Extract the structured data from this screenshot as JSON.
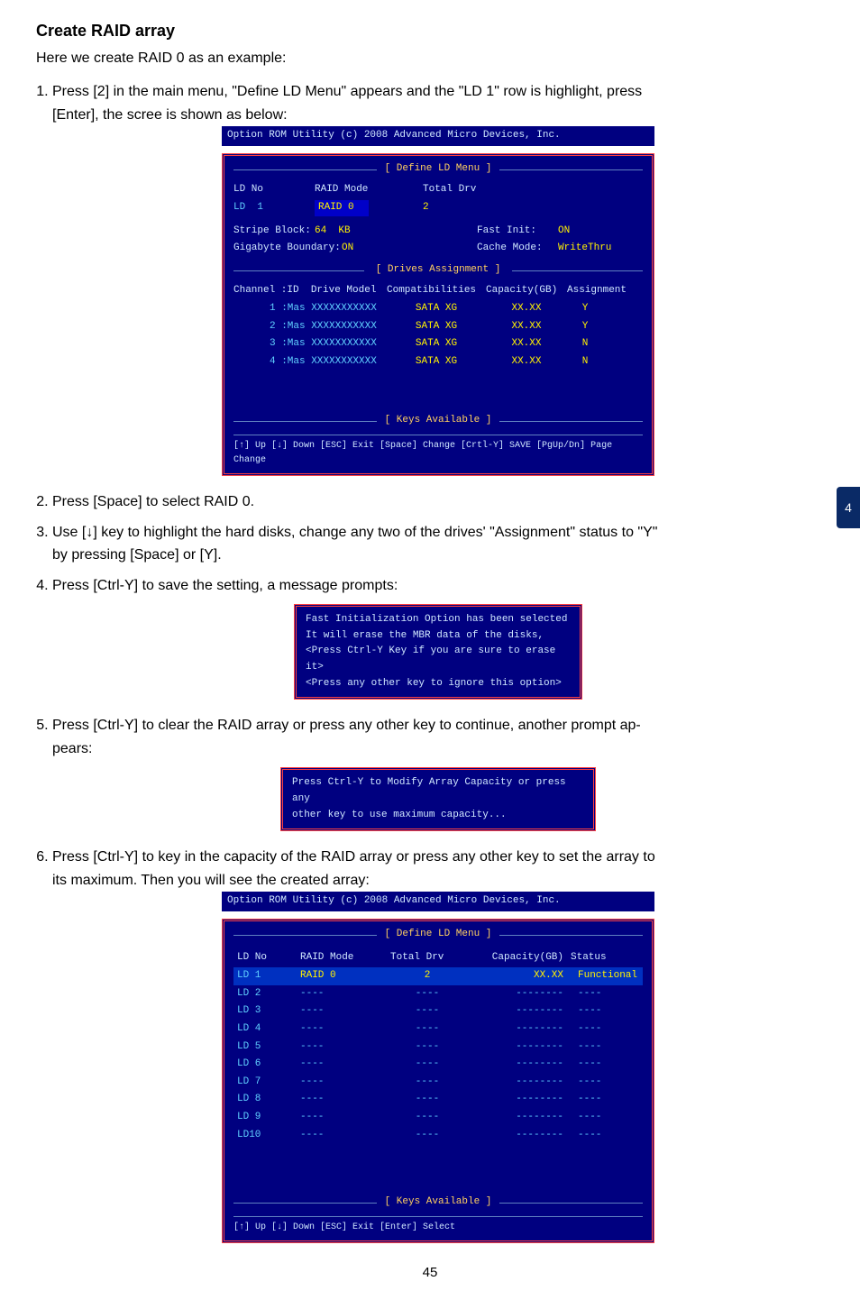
{
  "page": {
    "heading": "Create RAID array",
    "intro": "Here we create RAID 0 as an example:",
    "pageNumber": "45",
    "sideTab": "4"
  },
  "steps": {
    "s1a": "Press [2] in the main menu, \"Define LD Menu\" appears and the \"LD 1\" row is highlight, press",
    "s1b": "[Enter], the scree is shown as below:",
    "s2": "Press [Space] to select RAID 0.",
    "s3a": "Use [↓] key to highlight the hard disks, change any two of the drives' \"Assignment\" status to \"Y\"",
    "s3b": "by pressing [Space] or [Y].",
    "s4": "Press [Ctrl-Y] to save the setting, a message prompts:",
    "s5a": "Press [Ctrl-Y] to clear the RAID array or press any other key to continue, another prompt ap-",
    "s5b": "pears:",
    "s6a": "Press [Ctrl-Y] to key in the capacity of the RAID array or press any other key to set the array to",
    "s6b": "its maximum. Then you will see the created array:"
  },
  "bios1": {
    "topline": "Option ROM Utility (c) 2008 Advanced Micro Devices, Inc.",
    "menuTitle": "[ Define LD Menu ]",
    "ldno": "LD No",
    "raidmode": "RAID Mode",
    "totaldrv": "Total Drv",
    "ld1": "LD  1",
    "raid0": "RAID 0",
    "two": "2",
    "stripeLabel": "Stripe Block:",
    "stripeVal": "64  KB",
    "gigabyteLabel": "Gigabyte Boundary:",
    "gigabyteVal": "ON",
    "fastInitLabel": "Fast Init:",
    "fastInitVal": "ON",
    "cacheModeLabel": "Cache Mode:",
    "cacheModeVal": "WriteThru",
    "drivesTitle": "[ Drives Assignment ]",
    "colChannel": "Channel :ID  Drive Model",
    "colCompat": "Compatibilities",
    "colCap": "Capacity(GB)",
    "colAssign": "Assignment",
    "rows": [
      {
        "model": "1 :Mas XXXXXXXXXXX",
        "compat": "SATA XG",
        "cap": "XX.XX",
        "assign": "Y"
      },
      {
        "model": "2 :Mas XXXXXXXXXXX",
        "compat": "SATA XG",
        "cap": "XX.XX",
        "assign": "Y"
      },
      {
        "model": "3 :Mas XXXXXXXXXXX",
        "compat": "SATA XG",
        "cap": "XX.XX",
        "assign": "N"
      },
      {
        "model": "4 :Mas XXXXXXXXXXX",
        "compat": "SATA XG",
        "cap": "XX.XX",
        "assign": "N"
      }
    ],
    "keysTitle": "[ Keys Available ]",
    "footer": "[↑] Up  [↓] Down  [ESC] Exit  [Space] Change  [Crtl-Y] SAVE   [PgUp/Dn] Page Change"
  },
  "prompt1": {
    "l1": "Fast Initialization Option has been selected",
    "l2": "It will erase the MBR data of the disks,",
    "l3": "<Press Ctrl-Y Key if you are sure to erase it>",
    "l4": "<Press any other key to ignore this option>"
  },
  "prompt2": {
    "l1": "Press Ctrl-Y to Modify Array Capacity or press any",
    "l2": "other key to use maximum capacity..."
  },
  "bios2": {
    "topline": "Option ROM Utility (c) 2008 Advanced Micro Devices, Inc.",
    "menuTitle": "[ Define LD Menu ]",
    "hdr_ld": "LD No",
    "hdr_mode": "RAID Mode",
    "hdr_drv": "Total Drv",
    "hdr_cap": "Capacity(GB)",
    "hdr_status": "Status",
    "rows": [
      {
        "ld": "LD  1",
        "mode": "RAID 0",
        "drv": "2",
        "cap": "XX.XX",
        "status": "Functional",
        "hl": true
      },
      {
        "ld": "LD  2",
        "mode": "----",
        "drv": "----",
        "cap": "--------",
        "status": "----"
      },
      {
        "ld": "LD  3",
        "mode": "----",
        "drv": "----",
        "cap": "--------",
        "status": "----"
      },
      {
        "ld": "LD  4",
        "mode": "----",
        "drv": "----",
        "cap": "--------",
        "status": "----"
      },
      {
        "ld": "LD  5",
        "mode": "----",
        "drv": "----",
        "cap": "--------",
        "status": "----"
      },
      {
        "ld": "LD  6",
        "mode": "----",
        "drv": "----",
        "cap": "--------",
        "status": "----"
      },
      {
        "ld": "LD  7",
        "mode": "----",
        "drv": "----",
        "cap": "--------",
        "status": "----"
      },
      {
        "ld": "LD  8",
        "mode": "----",
        "drv": "----",
        "cap": "--------",
        "status": "----"
      },
      {
        "ld": "LD  9",
        "mode": "----",
        "drv": "----",
        "cap": "--------",
        "status": "----"
      },
      {
        "ld": "LD10",
        "mode": "----",
        "drv": "----",
        "cap": "--------",
        "status": "----"
      }
    ],
    "keysTitle": "[ Keys Available ]",
    "footer": "[↑] Up    [↓] Down    [ESC] Exit    [Enter] Select"
  }
}
